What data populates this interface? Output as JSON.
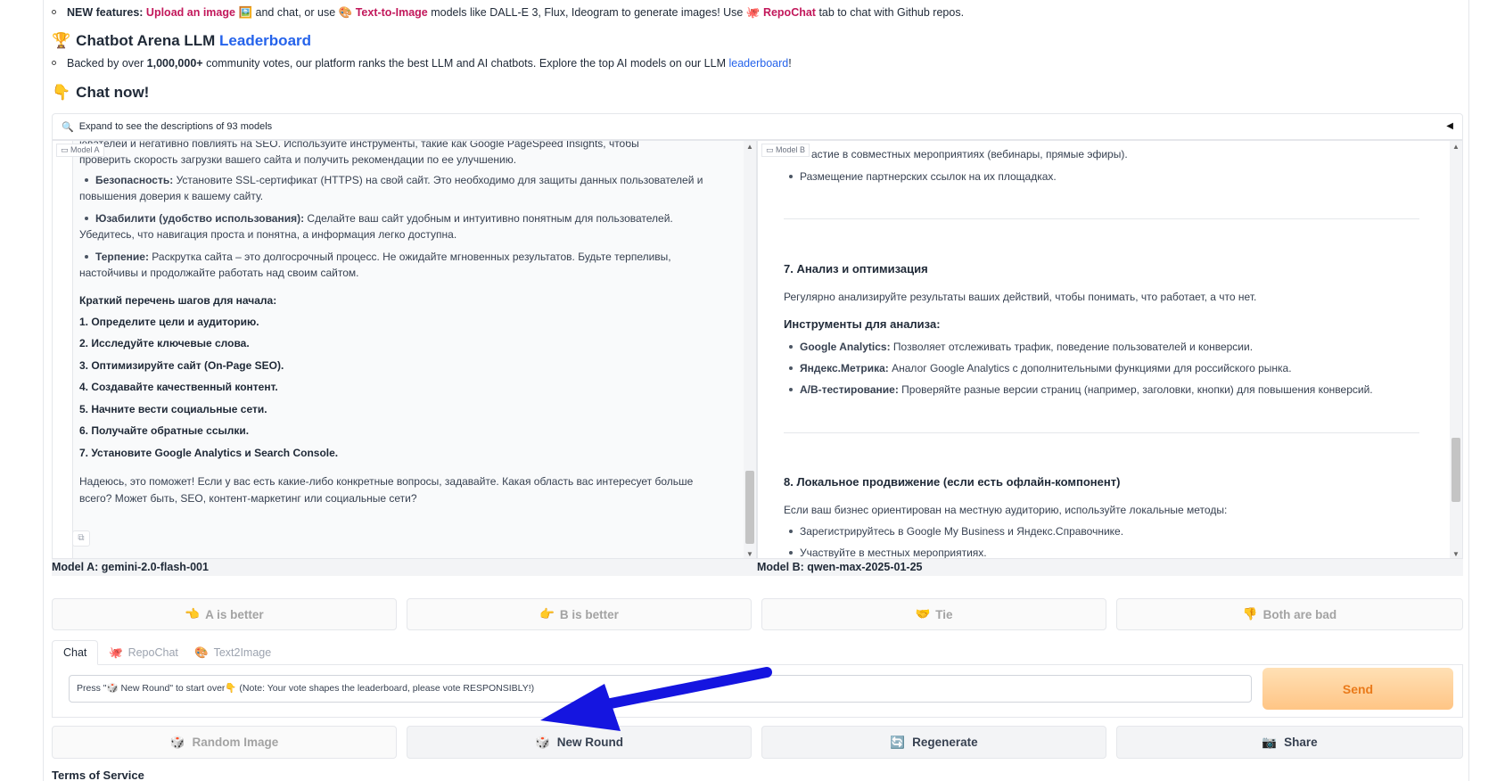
{
  "features": {
    "prefix": "NEW features:",
    "upload": "Upload an image",
    "upload_emoji": "🖼️",
    "mid1": "and chat, or use",
    "t2i_emoji": "🎨",
    "t2i": "Text-to-Image",
    "mid2": "models like DALL-E 3, Flux, Ideogram to generate images! Use",
    "repo_emoji": "🐙",
    "repo": "RepoChat",
    "end": "tab to chat with Github repos."
  },
  "leaderboard": {
    "emoji": "🏆",
    "title": "Chatbot Arena LLM",
    "link": "Leaderboard",
    "desc_pre": "Backed by over",
    "votes": "1,000,000+",
    "desc_mid": "community votes, our platform ranks the best LLM and AI chatbots. Explore the top AI models on our LLM",
    "desc_link": "leaderboard",
    "desc_end": "!"
  },
  "chat_now": {
    "emoji": "👇",
    "title": "Chat now!"
  },
  "expander": {
    "icon": "🔍",
    "label": "Expand to see the descriptions of 93 models",
    "toggle": "◀"
  },
  "panel_a": {
    "tag": "Model A",
    "lines": [
      "ювателей и негативно повлиять на SEO. Используйте инструменты, такие как Google PageSpeed Insights, чтобы",
      "проверить скорость загрузки вашего сайта и получить рекомендации по ее улучшению."
    ],
    "bullets": [
      {
        "bold": "Безопасность:",
        "text": " Установите SSL-сертификат (HTTPS) на свой сайт. Это необходимо для защиты данных пользователей и",
        "cont": "повышения доверия к вашему сайту."
      },
      {
        "bold": "Юзабилити (удобство использования):",
        "text": " Сделайте ваш сайт удобным и интуитивно понятным для пользователей.",
        "cont": "Убедитесь, что навигация проста и понятна, а информация легко доступна."
      },
      {
        "bold": "Терпение:",
        "text": " Раскрутка сайта – это долгосрочный процесс. Не ожидайте мгновенных результатов. Будьте терпеливы,",
        "cont": "настойчивы и продолжайте работать над своим сайтом."
      }
    ],
    "steps_title": "Краткий перечень шагов для начала:",
    "steps": [
      "1. Определите цели и аудиторию.",
      "2. Исследуйте ключевые слова.",
      "3. Оптимизируйте сайт (On-Page SEO).",
      "4. Создавайте качественный контент.",
      "5. Начните вести социальные сети.",
      "6. Получайте обратные ссылки.",
      "7. Установите Google Analytics и Search Console."
    ],
    "closing1": "Надеюсь, это поможет! Если у вас есть какие-либо конкретные вопросы, задавайте. Какая область вас интересует больше",
    "closing2": "всего? Может быть, SEO, контент-маркетинг или социальные сети?"
  },
  "panel_b": {
    "tag": "Model B",
    "top_line": "астие в совместных мероприятиях (вебинары, прямые эфиры).",
    "top_bullet": "Размещение партнерских ссылок на их площадках.",
    "sec7": "7. Анализ и оптимизация",
    "sec7_text": "Регулярно анализируйте результаты ваших действий, чтобы понимать, что работает, а что нет.",
    "tools_title": "Инструменты для анализа:",
    "tools": [
      {
        "bold": "Google Analytics:",
        "text": " Позволяет отслеживать трафик, поведение пользователей и конверсии."
      },
      {
        "bold": "Яндекс.Метрика:",
        "text": " Аналог Google Analytics с дополнительными функциями для российского рынка."
      },
      {
        "bold": "A/B-тестирование:",
        "text": " Проверяйте разные версии страниц (например, заголовки, кнопки) для повышения конверсий."
      }
    ],
    "sec8": "8. Локальное продвижение (если есть офлайн-компонент)",
    "sec8_text": "Если ваш бизнес ориентирован на местную аудиторию, используйте локальные методы:",
    "sec8_bullets": [
      "Зарегистрируйтесь в Google My Business и Яндекс.Справочнике.",
      "Участвуйте в местных мероприятиях."
    ]
  },
  "model_a_label": "Model A: gemini-2.0-flash-001",
  "model_b_label": "Model B: qwen-max-2025-01-25",
  "votes": {
    "a_better": {
      "emoji": "👈",
      "label": "A is better"
    },
    "b_better": {
      "emoji": "👉",
      "label": "B is better"
    },
    "tie": {
      "emoji": "🤝",
      "label": "Tie"
    },
    "both_bad": {
      "emoji": "👎",
      "label": "Both are bad"
    }
  },
  "tabs": [
    {
      "emoji": "",
      "label": "Chat"
    },
    {
      "emoji": "🐙",
      "label": "RepoChat"
    },
    {
      "emoji": "🎨",
      "label": "Text2Image"
    }
  ],
  "input": {
    "placeholder": "Press \"🎲 New Round\" to start over👇 (Note: Your vote shapes the leaderboard, please vote RESPONSIBLY!)"
  },
  "send_label": "Send",
  "actions": {
    "random_image": {
      "emoji": "🎲",
      "label": "Random Image"
    },
    "new_round": {
      "emoji": "🎲",
      "label": "New Round"
    },
    "regenerate": {
      "emoji": "🔄",
      "label": "Regenerate"
    },
    "share": {
      "emoji": "📷",
      "label": "Share"
    }
  },
  "tos": "Terms of Service",
  "colors": {
    "arrow": "#1515e0",
    "send_text": "#ea7a1a",
    "link": "#2563eb",
    "feature_link": "#c2185b"
  }
}
